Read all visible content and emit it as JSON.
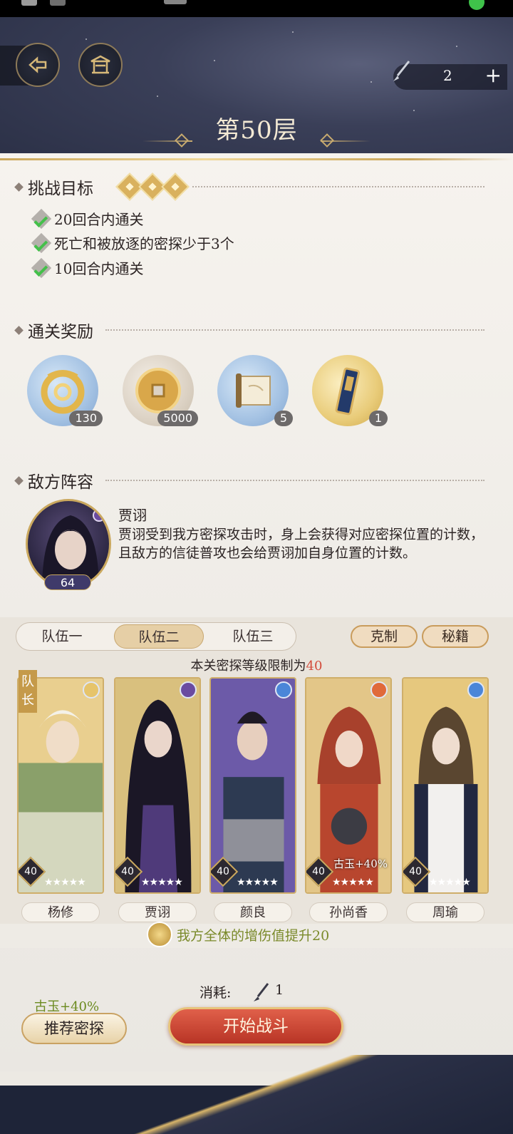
{
  "header": {
    "floor_title": "第50层",
    "resource_count": "2",
    "resource_plus": "+"
  },
  "challenge": {
    "heading": "挑战目标",
    "goals": [
      "20回合内通关",
      "死亡和被放逐的密探少于3个",
      "10回合内通关"
    ]
  },
  "rewards": {
    "heading": "通关奖励",
    "items": [
      {
        "icon": "dragon-jade-icon",
        "count": "130"
      },
      {
        "icon": "coin-icon",
        "count": "5000"
      },
      {
        "icon": "scroll-icon",
        "count": "5"
      },
      {
        "icon": "ink-stick-icon",
        "count": "1"
      }
    ]
  },
  "enemy": {
    "heading": "敌方阵容",
    "name": "贾诩",
    "level": "64",
    "description": "贾诩受到我方密探攻击时，身上会获得对应密探位置的计数，且敌方的信徒普攻也会给贾诩加自身位置的计数。"
  },
  "team": {
    "tabs": [
      "队伍一",
      "队伍二",
      "队伍三"
    ],
    "active_tab": "队伍二",
    "restrain_label": "克制",
    "secret_label": "秘籍",
    "limit_prefix": "本关密探等级限制为",
    "limit_value": "40",
    "leader_label_1": "队",
    "leader_label_2": "长",
    "heroes": [
      {
        "name": "杨修",
        "level": "40",
        "stars": "★★★★★"
      },
      {
        "name": "贾诩",
        "level": "40",
        "stars": "★★★★★"
      },
      {
        "name": "颜良",
        "level": "40",
        "stars": "★★★★★"
      },
      {
        "name": "孙尚香",
        "level": "40",
        "stars": "★★★★★",
        "bonus": "古玉+40%"
      },
      {
        "name": "周瑜",
        "level": "40",
        "stars": "★★★★★"
      }
    ],
    "buff_text": "我方全体的增伤值提升20"
  },
  "actions": {
    "cost_label": "消耗:",
    "cost_value": "1",
    "bonus_label": "古玉+40%",
    "recommend_label": "推荐密探",
    "start_label": "开始战斗"
  },
  "colors": {
    "accent_gold": "#c9a55a",
    "start_red": "#c8402e",
    "limit_red": "#d34b3b",
    "buff_green": "#7a8a2a"
  }
}
